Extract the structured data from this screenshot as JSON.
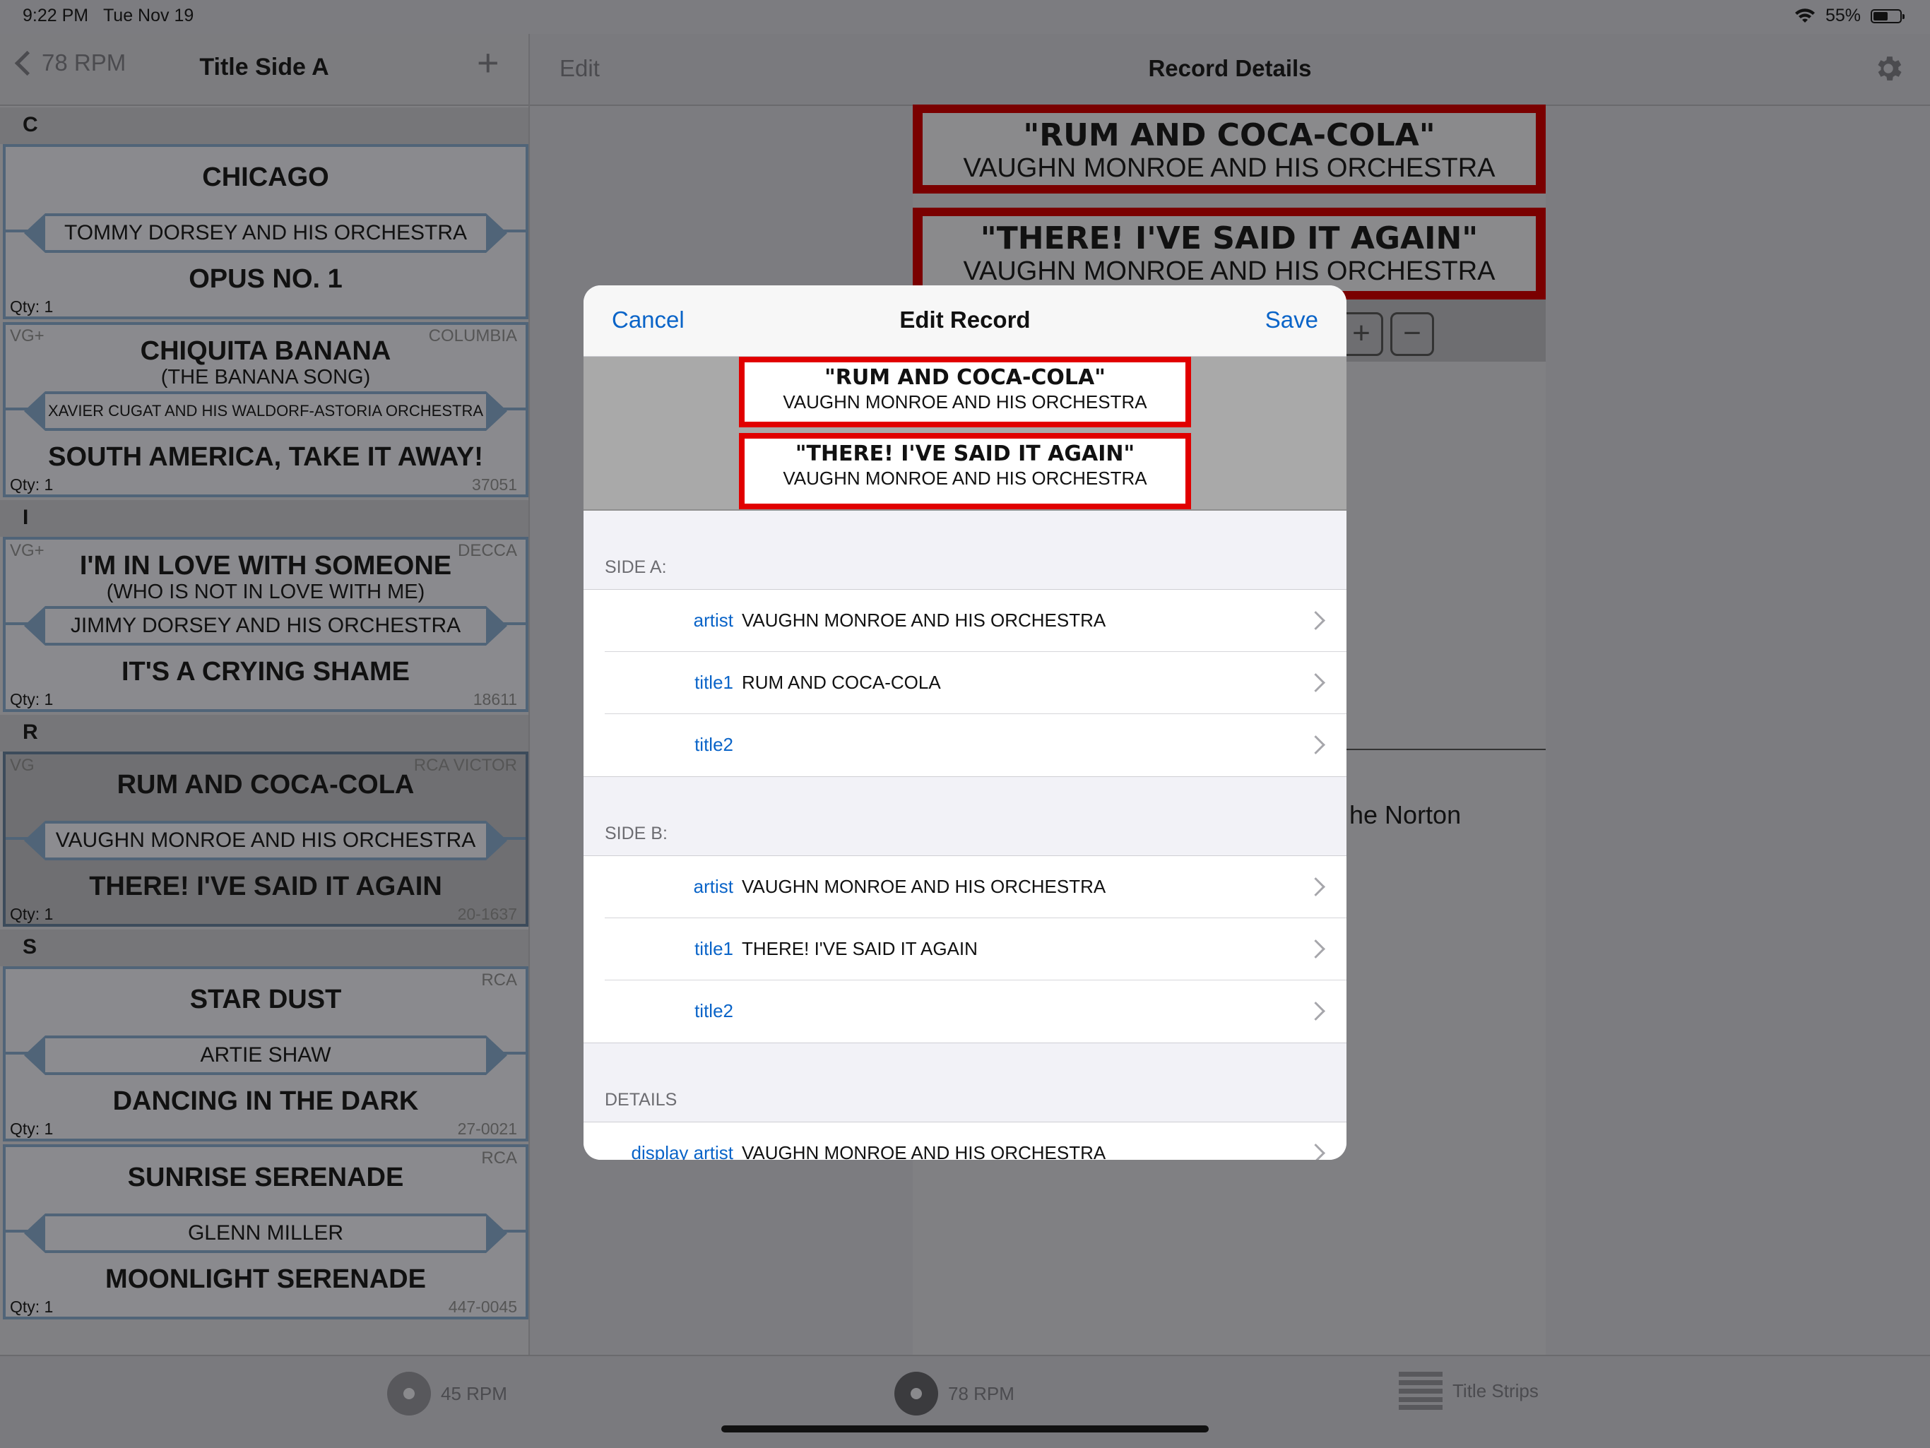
{
  "status": {
    "time": "9:22 PM",
    "date": "Tue Nov 19",
    "battery": "55%",
    "battery_level": 0.55
  },
  "master": {
    "back_label": "78 RPM",
    "title": "Title Side A",
    "add_icon": "plus-icon",
    "sections": [
      {
        "letter": "C",
        "records": [
          {
            "grade": "",
            "label": "",
            "title_a": "CHICAGO",
            "sub_a": "",
            "artist": "TOMMY DORSEY AND HIS ORCHESTRA",
            "title_b": "OPUS NO. 1",
            "qty": "Qty: 1",
            "catno": ""
          },
          {
            "grade": "VG+",
            "label": "COLUMBIA",
            "title_a": "CHIQUITA BANANA",
            "sub_a": "(THE BANANA SONG)",
            "artist": "XAVIER CUGAT AND HIS WALDORF-ASTORIA ORCHESTRA",
            "title_b": "SOUTH AMERICA, TAKE IT AWAY!",
            "qty": "Qty: 1",
            "catno": "37051"
          }
        ]
      },
      {
        "letter": "I",
        "records": [
          {
            "grade": "VG+",
            "label": "DECCA",
            "title_a": "I'M IN LOVE WITH SOMEONE",
            "sub_a": "(WHO IS NOT IN LOVE WITH ME)",
            "artist": "JIMMY DORSEY AND HIS ORCHESTRA",
            "title_b": "IT'S A CRYING SHAME",
            "qty": "Qty: 1",
            "catno": "18611"
          }
        ]
      },
      {
        "letter": "R",
        "records": [
          {
            "grade": "VG",
            "label": "RCA VICTOR",
            "title_a": "RUM AND COCA-COLA",
            "sub_a": "",
            "artist": "VAUGHN MONROE AND HIS ORCHESTRA",
            "title_b": "THERE! I'VE SAID IT AGAIN",
            "qty": "Qty: 1",
            "catno": "20-1637"
          }
        ]
      },
      {
        "letter": "S",
        "records": [
          {
            "grade": "",
            "label": "RCA",
            "title_a": "STAR DUST",
            "sub_a": "",
            "artist": "ARTIE SHAW",
            "title_b": "DANCING IN THE DARK",
            "qty": "Qty: 1",
            "catno": "27-0021"
          },
          {
            "grade": "",
            "label": "RCA",
            "title_a": "SUNRISE SERENADE",
            "sub_a": "",
            "artist": "GLENN MILLER",
            "title_b": "MOONLIGHT SERENADE",
            "qty": "Qty: 1",
            "catno": "447-0045"
          }
        ]
      }
    ]
  },
  "detail": {
    "edit_label": "Edit",
    "title": "Record Details",
    "settings_icon": "gear-icon",
    "strip_a_title": "\"RUM AND COCA-COLA\"",
    "strip_a_artist": "VAUGHN MONROE AND HIS ORCHESTRA",
    "strip_b_title": "\"THERE! I'VE SAID IT AGAIN\"",
    "strip_b_artist": "VAUGHN MONROE AND HIS ORCHESTRA",
    "plus_label": "+",
    "minus_label": "−",
    "partial_text": "he Norton",
    "partial_mark": ")"
  },
  "modal": {
    "cancel_label": "Cancel",
    "title": "Edit Record",
    "save_label": "Save",
    "preview": {
      "side_a_title": "\"RUM AND COCA-COLA\"",
      "side_a_artist": "VAUGHN MONROE AND HIS ORCHESTRA",
      "side_b_title": "\"THERE! I'VE SAID IT AGAIN\"",
      "side_b_artist": "VAUGHN MONROE AND HIS ORCHESTRA"
    },
    "side_a": {
      "header": "SIDE A:",
      "rows": [
        {
          "key": "artist",
          "value": "VAUGHN MONROE AND HIS ORCHESTRA"
        },
        {
          "key": "title1",
          "value": "RUM AND COCA-COLA"
        },
        {
          "key": "title2",
          "value": ""
        }
      ]
    },
    "side_b": {
      "header": "SIDE B:",
      "rows": [
        {
          "key": "artist",
          "value": "VAUGHN MONROE AND HIS ORCHESTRA"
        },
        {
          "key": "title1",
          "value": "THERE! I'VE SAID IT AGAIN"
        },
        {
          "key": "title2",
          "value": ""
        }
      ]
    },
    "details": {
      "header": "DETAILS",
      "rows": [
        {
          "key": "display artist",
          "value": "VAUGHN MONROE AND HIS ORCHESTRA"
        }
      ]
    }
  },
  "tabbar": {
    "tabs": [
      {
        "label": "45 RPM",
        "icon": "disc-icon"
      },
      {
        "label": "78 RPM",
        "icon": "disc-icon",
        "active": true
      },
      {
        "label": "Title Strips",
        "icon": "title-strips-icon"
      }
    ]
  },
  "colors": {
    "accent": "#0a64c8",
    "strip_red": "#e10000",
    "strip_border": "#506478"
  }
}
